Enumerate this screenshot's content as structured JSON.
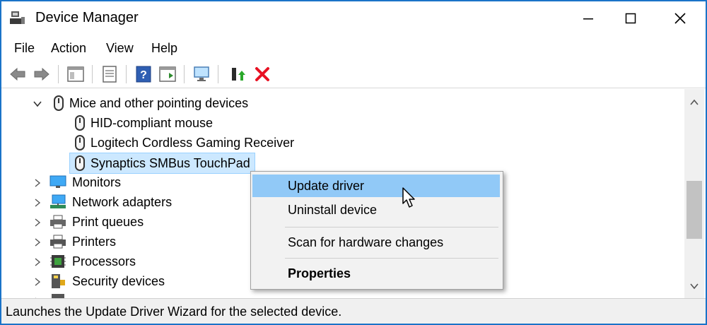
{
  "window": {
    "title": "Device Manager"
  },
  "menu": {
    "file": "File",
    "action": "Action",
    "view": "View",
    "help": "Help"
  },
  "tree": {
    "category_mice": "Mice and other pointing devices",
    "device_1": "HID-compliant mouse",
    "device_2": "Logitech Cordless Gaming Receiver",
    "device_3": "Synaptics SMBus TouchPad",
    "monitors": "Monitors",
    "network": "Network adapters",
    "print_queues": "Print queues",
    "printers": "Printers",
    "processors": "Processors",
    "security": "Security devices"
  },
  "context_menu": {
    "update": "Update driver",
    "uninstall": "Uninstall device",
    "scan": "Scan for hardware changes",
    "properties": "Properties"
  },
  "status": {
    "text": "Launches the Update Driver Wizard for the selected device."
  },
  "colors": {
    "accent": "#1a73c8",
    "selection": "#cce8ff",
    "menu_highlight": "#91c9f7",
    "remove_red": "#e81123"
  }
}
